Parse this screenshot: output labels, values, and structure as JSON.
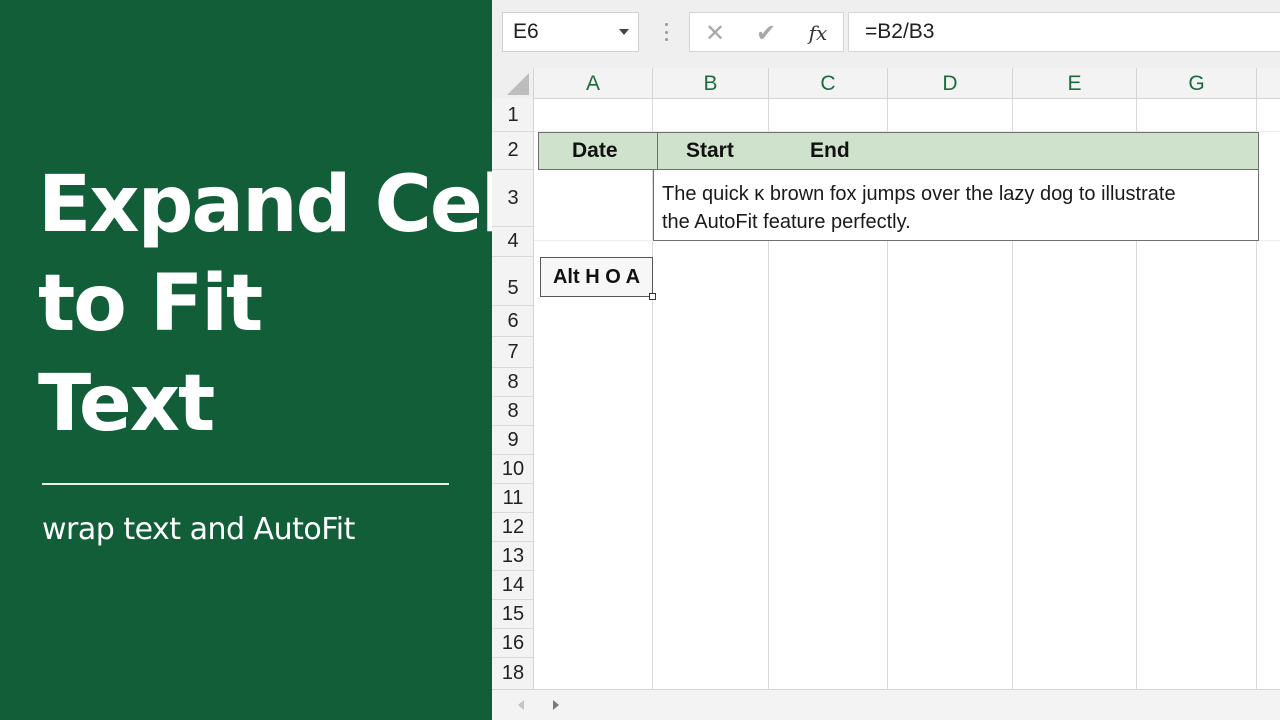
{
  "banner": {
    "title_lines": [
      "Expand Cell",
      "to Fit",
      "Text"
    ],
    "subtitle": "wrap text and AutoFit",
    "background_color": "#115e39"
  },
  "formula_bar": {
    "name_box": "E6",
    "cancel_icon": "✕",
    "enter_icon": "✔",
    "function_icon": "fx",
    "formula": "=B2/B3"
  },
  "columns": [
    "A",
    "B",
    "C",
    "D",
    "E",
    "G"
  ],
  "rows": [
    "1",
    "2",
    "3",
    "4",
    "5",
    "6",
    "7",
    "8",
    "8",
    "9",
    "10",
    "11",
    "12",
    "13",
    "14",
    "15",
    "16",
    "18"
  ],
  "table": {
    "header_fill": "#cfe3cc",
    "headers": [
      "Date",
      "Start",
      "End"
    ],
    "wrapped_text_lines": [
      "The quick ĸ brown fox jumps over the lazy dog to illustrate",
      "the AutoFit feature perfectly."
    ]
  },
  "shortcut_tip": "Alt H O A",
  "accent_color": "#1e6b3f"
}
